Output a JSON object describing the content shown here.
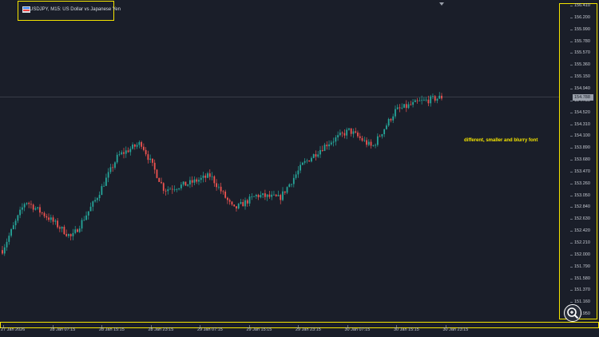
{
  "header": {
    "symbol_title": "USDJPY, M15:  US Dollar vs Japanese Yen"
  },
  "annotation": {
    "text": "different, smaller and blurry font"
  },
  "icons": {
    "symbol": "chart-flag-icon",
    "zoom": "magnifier-plus-icon",
    "top_marker": "triangle-down-icon"
  },
  "colors": {
    "background": "#1a1e29",
    "bull_candle": "#26a69a",
    "bear_candle": "#ef5350",
    "highlight_border": "#f5e500",
    "annotation_text": "#f5e500",
    "current_price_bg": "#9aa0aa"
  },
  "price_axis": {
    "labels": [
      "156.410",
      "156.200",
      "155.990",
      "155.780",
      "155.570",
      "155.360",
      "155.150",
      "154.940",
      "154.730",
      "154.520",
      "154.310",
      "154.100",
      "153.890",
      "153.680",
      "153.470",
      "153.260",
      "153.050",
      "152.840",
      "152.630",
      "152.420",
      "152.210",
      "152.000",
      "151.790",
      "151.580",
      "151.370",
      "151.160",
      "150.950"
    ],
    "current_price": "154.788"
  },
  "time_axis": {
    "labels": [
      "27 Jan 2026",
      "28 Jan 07:15",
      "28 Jan 15:15",
      "28 Jan 23:15",
      "29 Jan 07:15",
      "29 Jan 15:15",
      "29 Jan 23:15",
      "30 Jan 07:15",
      "30 Jan 15:15",
      "30 Jan 23:15"
    ]
  },
  "chart_data": {
    "type": "candlestick",
    "series_key_points": [
      {
        "time": "27 Jan 2026",
        "close": 152.08
      },
      {
        "time": "27 Jan ~19:00",
        "close": 152.95
      },
      {
        "time": "28 Jan 07:15",
        "close": 152.65
      },
      {
        "time": "28 Jan ~09:00",
        "close": 152.3
      },
      {
        "time": "28 Jan 15:15",
        "close": 152.95
      },
      {
        "time": "28 Jan ~17:00",
        "close": 153.75
      },
      {
        "time": "28 Jan ~18:30",
        "close": 153.98
      },
      {
        "time": "28 Jan 23:15",
        "close": 153.15
      },
      {
        "time": "29 Jan 07:15",
        "close": 153.25
      },
      {
        "time": "29 Jan ~11:00",
        "close": 153.4
      },
      {
        "time": "29 Jan 15:15",
        "close": 152.8
      },
      {
        "time": "29 Jan ~19:00",
        "close": 153.05
      },
      {
        "time": "29 Jan 23:15",
        "close": 153.0
      },
      {
        "time": "30 Jan ~01:00",
        "close": 153.6
      },
      {
        "time": "30 Jan 07:15",
        "close": 153.95
      },
      {
        "time": "30 Jan ~10:30",
        "close": 154.2
      },
      {
        "time": "30 Jan ~12:00",
        "close": 153.9
      },
      {
        "time": "30 Jan 15:15",
        "close": 154.55
      },
      {
        "time": "30 Jan ~17:00",
        "close": 154.7
      },
      {
        "time": "30 Jan 23:15",
        "close": 154.788
      }
    ],
    "ylim": [
      150.85,
      156.5
    ],
    "current_price": 154.788,
    "grid": false
  }
}
